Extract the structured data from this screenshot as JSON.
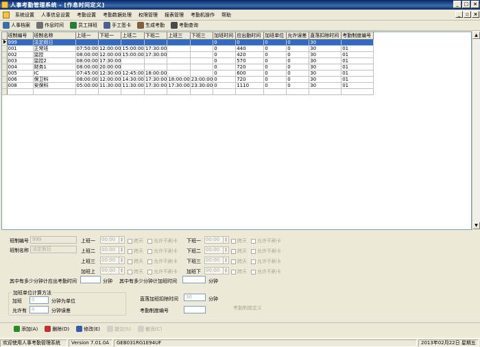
{
  "window": {
    "title": "人事考勤管理系统 - [作息时间定义]"
  },
  "menu": [
    "系统设置",
    "人事信息设置",
    "考勤设置",
    "考勤数据处理",
    "权限管理",
    "报表管理",
    "考勤机操作",
    "帮助"
  ],
  "toolbar": [
    {
      "label": "人事档案",
      "icon": "person-icon",
      "color": "#3a6ea5"
    },
    {
      "label": "作息时间",
      "icon": "calendar-icon",
      "color": "#707070"
    },
    {
      "label": "员工排班",
      "icon": "schedule-icon",
      "color": "#2a7a3a"
    },
    {
      "label": "手工签卡",
      "icon": "card-icon",
      "color": "#4a6090"
    },
    {
      "label": "生成考勤",
      "icon": "generate-icon",
      "color": "#806040"
    },
    {
      "label": "考勤查询",
      "icon": "query-icon",
      "color": "#4a4a4a"
    }
  ],
  "table": {
    "columns": [
      "班制编号",
      "班制名称",
      "上班一",
      "下班一",
      "上班二",
      "下班二",
      "上班三",
      "下班三",
      "加班时间",
      "应出勤时间",
      "加班单位",
      "允许误差",
      "直落扣除时间",
      "考勤制度编号"
    ],
    "rows": [
      [
        "999",
        "法定假日",
        "",
        "",
        "",
        "",
        "",
        "",
        "0",
        "0",
        "0",
        "0",
        "30",
        ""
      ],
      [
        "001",
        "正常班",
        "07:50:00",
        "12:00:00",
        "15:00:00",
        "17:30:00",
        "",
        "",
        "0",
        "440",
        "0",
        "0",
        "30",
        "01"
      ],
      [
        "002",
        "监控",
        "08:00:00",
        "12:00:00",
        "15:00:00",
        "17:30:00",
        "",
        "",
        "0",
        "420",
        "0",
        "0",
        "30",
        "01"
      ],
      [
        "003",
        "监控2",
        "08:00:00",
        "17:30:00",
        "",
        "",
        "",
        "",
        "0",
        "570",
        "0",
        "0",
        "30",
        "01"
      ],
      [
        "004",
        "财务1",
        "08:00:00",
        "20:00:00",
        "",
        "",
        "",
        "",
        "0",
        "720",
        "0",
        "0",
        "30",
        "01"
      ],
      [
        "005",
        "IC",
        "07:45:00",
        "12:30:00",
        "12:45:00",
        "18:00:00",
        "",
        "",
        "0",
        "600",
        "0",
        "0",
        "30",
        "01"
      ],
      [
        "006",
        "保卫科",
        "08:00:00",
        "12:00:00",
        "14:30:00",
        "17:30:00",
        "18:00:00",
        "23:00:00",
        "0",
        "720",
        "0",
        "0",
        "30",
        "01"
      ],
      [
        "008",
        "安保科",
        "05:00:00",
        "11:30:00",
        "11:30:00",
        "17:30:00",
        "17:30:00",
        "23:30:00",
        "0",
        "1110",
        "0",
        "0",
        "30",
        "01"
      ]
    ]
  },
  "form": {
    "shift_code_label": "班制编号",
    "shift_code_value": "999",
    "shift_name_label": "班制名称",
    "shift_name_value": "法定假日",
    "on1": "上班一",
    "off1": "下班一",
    "on2": "上班二",
    "off2": "下班二",
    "on3": "上班三",
    "off3": "下班三",
    "on_ot": "加班上",
    "off_ot": "加班下",
    "time_placeholder": "00:00",
    "cross_day": "跨天",
    "no_card": "允许不刷卡",
    "required_minutes_label": "其中有多少分钟计应出考勤时间",
    "ot_minutes_label": "其中有多少分钟计加班时间",
    "minute_unit": "分钟",
    "ot_group_title": "加班单位计算方法",
    "ot_label": "加班",
    "ot_value": "0",
    "ot_unit_suffix": "分钟为单位",
    "allow_label": "允许有",
    "allow_value": "0",
    "allow_suffix": "分钟误差",
    "deduct_label": "直落加班扣除时间",
    "deduct_value": "30",
    "deduct_unit": "分钟",
    "rule_code_label": "考勤制度编号",
    "rule_def_label": "考勤制度定义"
  },
  "actions": [
    {
      "label": "添加(A)",
      "icon": "add-icon",
      "color": "#2a8a2a",
      "enabled": true
    },
    {
      "label": "删除(D)",
      "icon": "delete-icon",
      "color": "#c03030",
      "enabled": true
    },
    {
      "label": "修改(E)",
      "icon": "edit-icon",
      "color": "#3a5aa5",
      "enabled": true
    },
    {
      "label": "提交(S)",
      "icon": "submit-icon",
      "color": "#aca899",
      "enabled": false
    },
    {
      "label": "撤消(C)",
      "icon": "undo-icon",
      "color": "#aca899",
      "enabled": false
    }
  ],
  "status": {
    "welcome": "欢迎使用人事考勤管理系统",
    "version": "Version 7.01.0A",
    "code": "GEB031RG1E94UF",
    "date": "2013年02月22日 星期五"
  }
}
